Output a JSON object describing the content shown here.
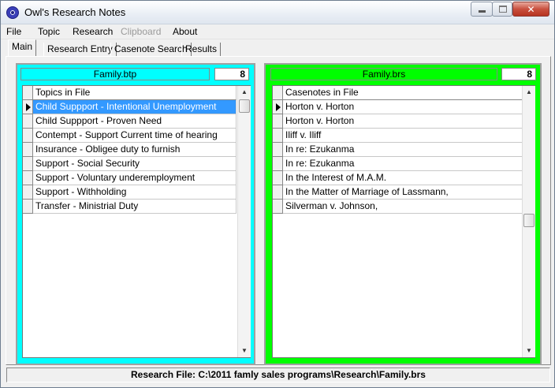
{
  "window": {
    "title": "Owl's Research Notes",
    "minimize_glyph": "—",
    "close_glyph": "✕"
  },
  "menu": {
    "items": [
      {
        "label": "File",
        "enabled": true
      },
      {
        "label": "Topic",
        "enabled": true
      },
      {
        "label": "Research",
        "enabled": true
      },
      {
        "label": "Clipboard",
        "enabled": false
      },
      {
        "label": "About",
        "enabled": true
      }
    ]
  },
  "tabs": {
    "items": [
      {
        "label": "Main",
        "active": true
      },
      {
        "label": "Research Entry",
        "active": false
      },
      {
        "label": "Casenote Search",
        "active": false
      },
      {
        "label": "Results",
        "active": false
      }
    ]
  },
  "topics_panel": {
    "file_name": "Family.btp",
    "count": "8",
    "column_header": "Topics in File",
    "bg_color": "#00ffff",
    "selected_index": 0,
    "rows": [
      "Child Suppport - Intentional Unemployment",
      "Child Suppport - Proven Need",
      "Contempt - Support Current time of hearing",
      "Insurance - Obligee duty to furnish",
      "Support - Social Security",
      "Support - Voluntary underemployment",
      "Support - Withholding",
      "Transfer - Ministrial Duty"
    ]
  },
  "casenotes_panel": {
    "file_name": "Family.brs",
    "count": "8",
    "column_header": "Casenotes in File",
    "bg_color": "#00ff00",
    "current_index": 0,
    "rows": [
      "Horton v. Horton",
      "Horton v. Horton",
      "Iliff v. Iliff",
      "In re: Ezukanma",
      "In re: Ezukanma",
      "In the Interest of M.A.M.",
      "In the Matter of Marriage of Lassmann,",
      "Silverman v. Johnson,"
    ]
  },
  "scroll": {
    "up_glyph": "▲",
    "down_glyph": "▼"
  },
  "status": {
    "text": "Research File: C:\\2011 famly sales programs\\Research\\Family.brs"
  }
}
